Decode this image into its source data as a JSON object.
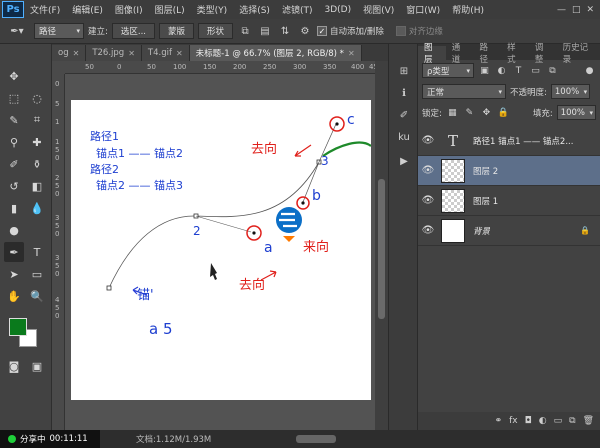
{
  "app": {
    "logo": "Ps",
    "menu": [
      "文件(F)",
      "编辑(E)",
      "图像(I)",
      "图层(L)",
      "类型(Y)",
      "选择(S)",
      "滤镜(T)",
      "3D(D)",
      "视图(V)",
      "窗口(W)",
      "帮助(H)"
    ],
    "window_controls": [
      "—",
      "□",
      "✕"
    ]
  },
  "options_bar": {
    "mode_select": "路径",
    "build_label": "建立:",
    "selection_btn": "选区...",
    "mask_btn": "蒙版",
    "shape_btn": "形状",
    "auto_add_label": "自动添加/删除",
    "auto_add_checked": true,
    "align_edges_label": "对齐边缘",
    "align_edges_checked": false
  },
  "doc_tabs": [
    {
      "label": "og",
      "active": false
    },
    {
      "label": "T26.jpg",
      "active": false
    },
    {
      "label": "T4.gif",
      "active": false
    },
    {
      "label": "未标题-1 @ 66.7% (图层 2, RGB/8) *",
      "active": true
    }
  ],
  "ruler": {
    "h_ticks": [
      "50",
      "0",
      "50",
      "100",
      "150",
      "200",
      "250",
      "300",
      "350",
      "400",
      "450"
    ],
    "v_ticks": [
      "0",
      "5",
      "1",
      "1",
      "5",
      "0",
      "2",
      "5",
      "0",
      "3",
      "5",
      "0",
      "3",
      "5",
      "0",
      "4",
      "5",
      "0"
    ]
  },
  "canvas": {
    "path_text": [
      "路径1",
      "锚点1 —— 锚点2",
      "路径2",
      "锚点2 —— 锚点3"
    ],
    "labels": {
      "n2": "2",
      "n3": "3",
      "a": "a",
      "b": "b",
      "c": "c",
      "a5": "a 5",
      "qufang1": "去向",
      "qufang2": "去向",
      "laifang": "来向",
      "mao": "锚'"
    }
  },
  "layers_panel": {
    "tabs": [
      "图层",
      "通道",
      "路径",
      "样式",
      "调整",
      "历史记录"
    ],
    "kind_select": "ρ类型",
    "blend_mode": "正常",
    "opacity_label": "不透明度:",
    "opacity_value": "100%",
    "lock_label": "锁定:",
    "fill_label": "填充:",
    "fill_value": "100%",
    "layers": [
      {
        "name": "路径1 锚点1 —— 锚点2...",
        "type": "text",
        "selected": false
      },
      {
        "name": "图层 2",
        "type": "pixel",
        "selected": true
      },
      {
        "name": "图层 1",
        "type": "pixel",
        "selected": false
      },
      {
        "name": "背景",
        "type": "background",
        "selected": false
      }
    ],
    "footer_icons": [
      "fx",
      "◘",
      "◐",
      "▭",
      "⧉",
      "🗑"
    ]
  },
  "status": {
    "share_label": "分享中",
    "share_time": "00:11:11",
    "doc_label": "文档:1.12M/",
    "doc_size": "1.93M"
  },
  "colors": {
    "foreground": "#0a7a1c",
    "background": "#ffffff",
    "annotation_red": "#e0201b",
    "annotation_blue": "#1e3fd0"
  }
}
